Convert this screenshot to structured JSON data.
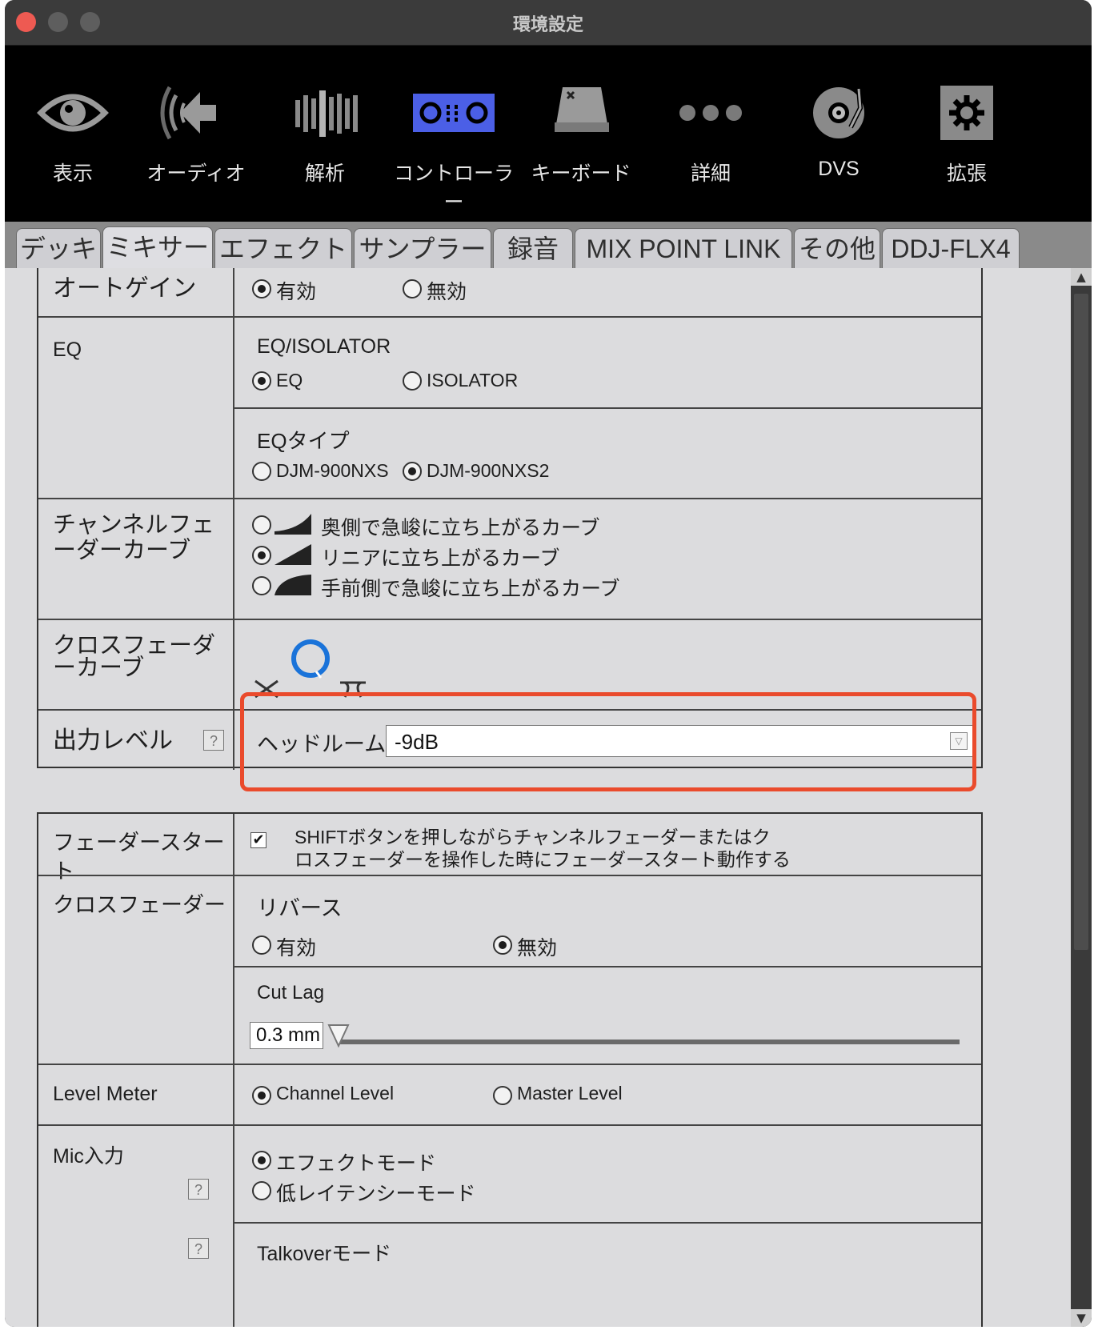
{
  "window": {
    "title": "環境設定"
  },
  "toolbar": {
    "items": [
      {
        "label": "表示",
        "icon": "eye-icon"
      },
      {
        "label": "オーディオ",
        "icon": "speaker-icon"
      },
      {
        "label": "解析",
        "icon": "waveform-analysis-icon"
      },
      {
        "label": "コントローラー",
        "icon": "controller-icon",
        "active": true
      },
      {
        "label": "キーボード",
        "icon": "keyboard-icon"
      },
      {
        "label": "詳細",
        "icon": "more-dots-icon"
      },
      {
        "label": "DVS",
        "icon": "turntable-icon"
      },
      {
        "label": "拡張",
        "icon": "extension-gear-icon"
      }
    ],
    "active_color": "#4b5fe6"
  },
  "tabs": [
    "デッキ",
    "ミキサー",
    "エフェクト",
    "サンプラー",
    "録音",
    "MIX POINT LINK",
    "その他",
    "DDJ-FLX4"
  ],
  "active_tab": "ミキサー",
  "section1": {
    "autogain": {
      "label": "オートゲイン",
      "on": "有効",
      "off": "無効",
      "selected": "有効"
    },
    "eq": {
      "label": "EQ",
      "mode_title": "EQ/ISOLATOR",
      "opt_eq": "EQ",
      "opt_isolator": "ISOLATOR",
      "type_title": "EQタイプ",
      "opt_900nxs": "DJM-900NXS",
      "opt_900nxs2": "DJM-900NXS2"
    },
    "channel_curve": {
      "label": "チャンネルフェーダーカーブ",
      "opt1": "奥側で急峻に立ち上がるカーブ",
      "opt2": "リニアに立ち上がるカーブ",
      "opt3": "手前側で急峻に立ち上がるカーブ",
      "selected": 2
    },
    "cross_curve": {
      "label": "クロスフェーダーカーブ"
    },
    "output": {
      "label": "出力レベル",
      "headroom_label": "ヘッドルーム",
      "headroom_value": "-9dB"
    }
  },
  "section2": {
    "fader_start": {
      "label": "フェーダースタート",
      "text_line1": "SHIFTボタンを押しながらチャンネルフェーダーまたはク",
      "text_line2": "ロスフェーダーを操作した時にフェーダースタート動作する",
      "checked": true
    },
    "crossfader": {
      "label": "クロスフェーダー",
      "reverse_title": "リバース",
      "on": "有効",
      "off": "無効",
      "selected": "無効",
      "cut_lag_title": "Cut Lag",
      "cut_lag_value": "0.3 mm",
      "cut_lag_level": 0
    },
    "level_meter": {
      "label": "Level Meter",
      "opt1": "Channel Level",
      "opt2": "Master Level",
      "selected": "Channel Level"
    },
    "mic_input": {
      "label": "Mic入力",
      "opt1": "エフェクトモード",
      "opt2": "低レイテンシーモード",
      "selected": "エフェクトモード",
      "talkover_title": "Talkoverモード"
    }
  },
  "colors": {
    "highlight": "#ea4b2c",
    "panel_bg": "#dcdcde",
    "toolbar_bg": "#000000"
  }
}
